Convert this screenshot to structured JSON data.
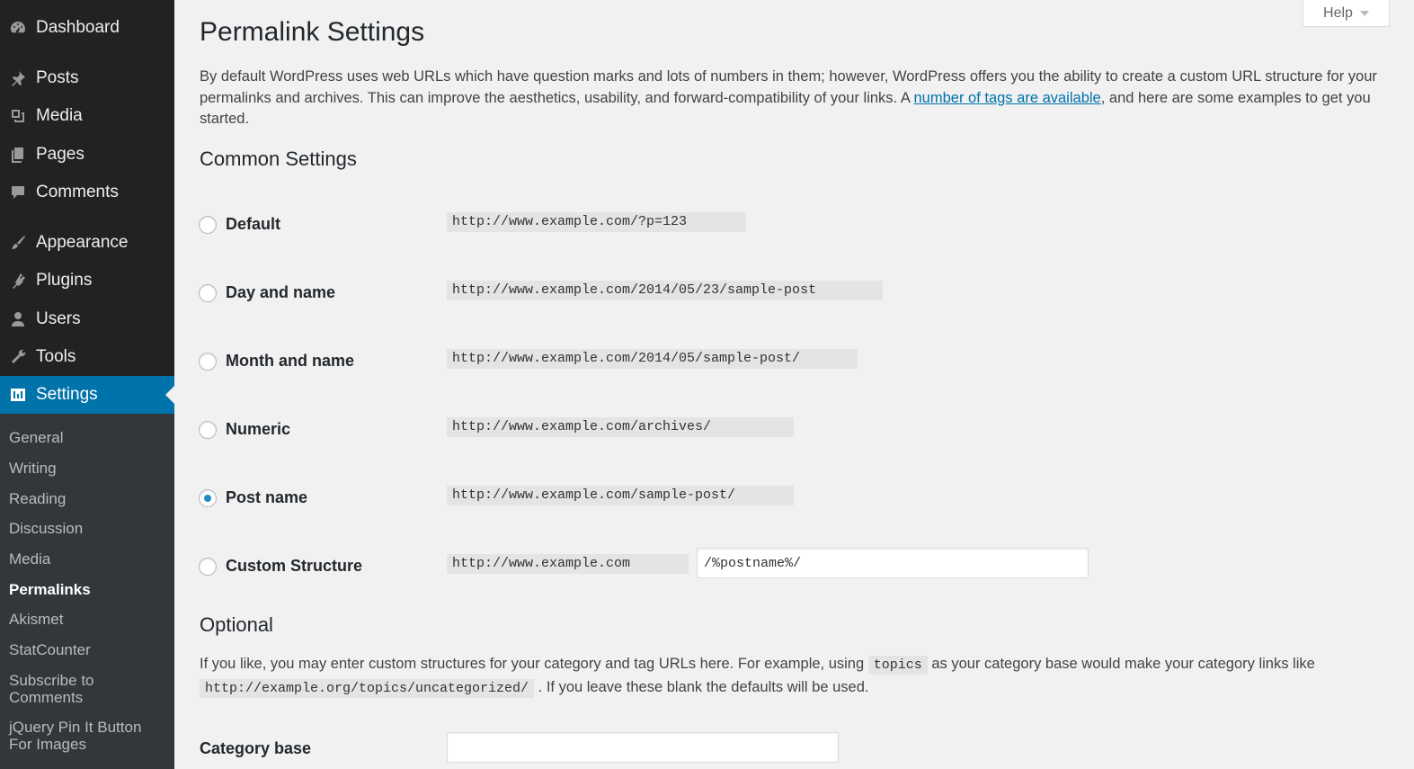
{
  "sidebar": {
    "items": [
      {
        "label": "Dashboard",
        "icon": "dashboard-icon"
      },
      {
        "label": "Posts",
        "icon": "pin-icon"
      },
      {
        "label": "Media",
        "icon": "media-icon"
      },
      {
        "label": "Pages",
        "icon": "pages-icon"
      },
      {
        "label": "Comments",
        "icon": "comment-icon"
      },
      {
        "label": "Appearance",
        "icon": "brush-icon"
      },
      {
        "label": "Plugins",
        "icon": "plugin-icon"
      },
      {
        "label": "Users",
        "icon": "user-icon"
      },
      {
        "label": "Tools",
        "icon": "wrench-icon"
      },
      {
        "label": "Settings",
        "icon": "settings-icon"
      }
    ],
    "submenu": [
      "General",
      "Writing",
      "Reading",
      "Discussion",
      "Media",
      "Permalinks",
      "Akismet",
      "StatCounter",
      "Subscribe to Comments",
      "jQuery Pin It Button For Images"
    ],
    "active_item": "Settings",
    "current_subitem": "Permalinks"
  },
  "help": {
    "label": "Help"
  },
  "page": {
    "title": "Permalink Settings",
    "intro_before_link": "By default WordPress uses web URLs which have question marks and lots of numbers in them; however, WordPress offers you the ability to create a custom URL structure for your permalinks and archives. This can improve the aesthetics, usability, and forward-compatibility of your links. A ",
    "intro_link": "number of tags are available",
    "intro_after_link": ", and here are some examples to get you started."
  },
  "common": {
    "heading": "Common Settings",
    "options": [
      {
        "label": "Default",
        "example": "http://www.example.com/?p=123",
        "checked": false
      },
      {
        "label": "Day and name",
        "example": "http://www.example.com/2014/05/23/sample-post",
        "checked": false
      },
      {
        "label": "Month and name",
        "example": "http://www.example.com/2014/05/sample-post/",
        "checked": false
      },
      {
        "label": "Numeric",
        "example": "http://www.example.com/archives/",
        "checked": false
      },
      {
        "label": "Post name",
        "example": "http://www.example.com/sample-post/",
        "checked": true
      },
      {
        "label": "Custom Structure",
        "example": "http://www.example.com",
        "checked": false
      }
    ],
    "custom_value": "/%postname%/"
  },
  "optional": {
    "heading": "Optional",
    "text_1": "If you like, you may enter custom structures for your category and tag URLs here. For example, using ",
    "code_1": "topics",
    "text_2": " as your category base would make your category links like ",
    "code_2": "http://example.org/topics/uncategorized/",
    "text_3": " . If you leave these blank the defaults will be used.",
    "category_base_label": "Category base",
    "category_base_value": ""
  },
  "colors": {
    "sidebar_bg": "#222222",
    "active_bg": "#0073aa",
    "link": "#0073aa",
    "page_bg": "#f1f1f1"
  }
}
